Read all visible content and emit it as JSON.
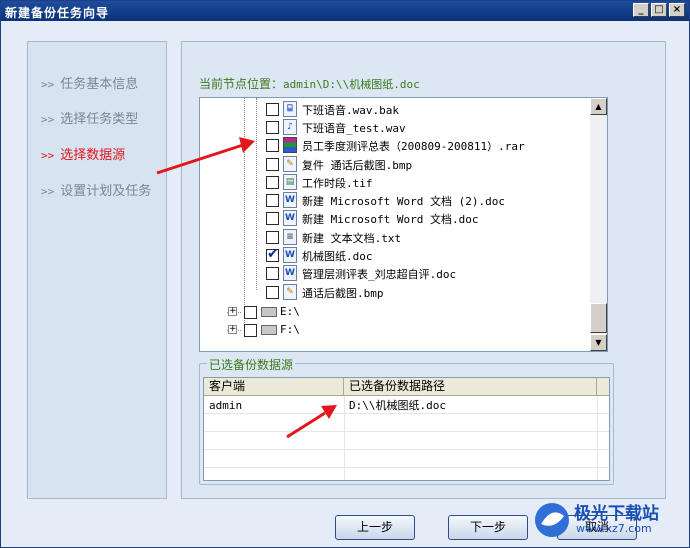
{
  "window": {
    "title": "新建备份任务向导"
  },
  "steps": [
    {
      "label": "任务基本信息",
      "active": false
    },
    {
      "label": "选择任务类型",
      "active": false
    },
    {
      "label": "选择数据源",
      "active": true
    },
    {
      "label": "设置计划及任务",
      "active": false
    }
  ],
  "node_position": {
    "label": "当前节点位置：",
    "path": "admin\\D:\\\\机械图纸.doc"
  },
  "tree": {
    "files": [
      {
        "name": "下班语音.wav.bak",
        "icon": "generic-file-icon",
        "checked": false
      },
      {
        "name": "下班语音_test.wav",
        "icon": "audio-file-icon",
        "checked": false
      },
      {
        "name": "员工季度测评总表（200809-200811）.rar",
        "icon": "archive-file-icon",
        "checked": false
      },
      {
        "name": "复件 通话后截图.bmp",
        "icon": "image-file-icon",
        "checked": false
      },
      {
        "name": "工作时段.tif",
        "icon": "image-file-icon",
        "checked": false
      },
      {
        "name": "新建 Microsoft Word 文档 (2).doc",
        "icon": "word-file-icon",
        "checked": false
      },
      {
        "name": "新建 Microsoft Word 文档.doc",
        "icon": "word-file-icon",
        "checked": false
      },
      {
        "name": "新建 文本文档.txt",
        "icon": "text-file-icon",
        "checked": false
      },
      {
        "name": "机械图纸.doc",
        "icon": "word-file-icon",
        "checked": true
      },
      {
        "name": "管理层测评表_刘忠超自评.doc",
        "icon": "word-file-icon",
        "checked": false
      },
      {
        "name": "通话后截图.bmp",
        "icon": "image-file-icon",
        "checked": false
      }
    ],
    "drives": [
      {
        "name": "E:\\",
        "expander": "+"
      },
      {
        "name": "F:\\",
        "expander": "+"
      }
    ]
  },
  "selected_group": {
    "title": "已选备份数据源"
  },
  "table": {
    "headers": [
      "客户端",
      "已选备份数据路径"
    ],
    "rows": [
      [
        "admin",
        "D:\\\\机械图纸.doc"
      ]
    ]
  },
  "buttons": {
    "prev": "上一步",
    "next": "下一步",
    "cancel": "取消"
  },
  "titlebar_buttons": {
    "minimize": "_",
    "maximize": "□",
    "close": "×"
  },
  "watermark": {
    "text": "极光下载站",
    "url": "www.xz7.com"
  },
  "colors": {
    "active_step": "#e2161d",
    "title_bar": "#0b3178",
    "arrow": "#e2161d"
  }
}
